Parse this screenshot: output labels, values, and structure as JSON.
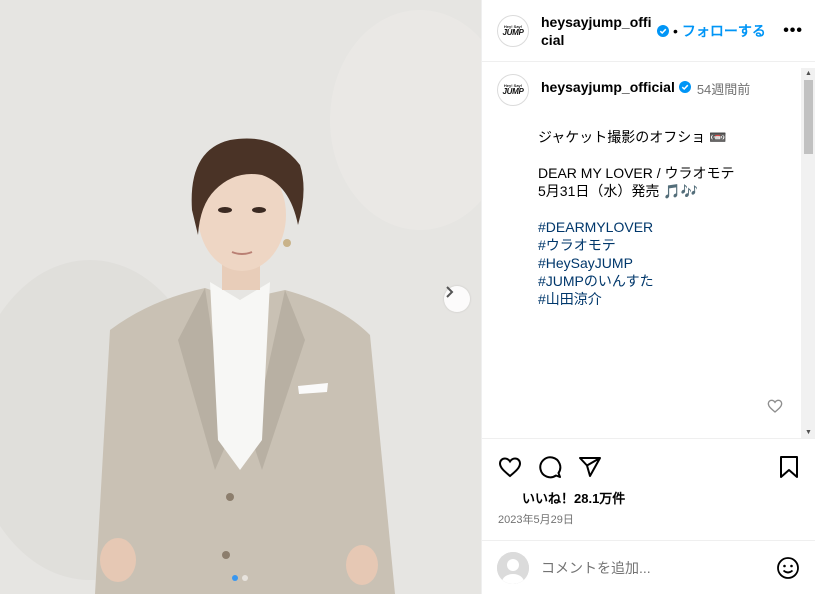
{
  "post": {
    "username": "heysayjump_official",
    "header_username_line1": "heysayjump_offici",
    "header_username_line2": "al",
    "separator": "•",
    "follow_label": "フォローする",
    "more_label": "•••",
    "avatar_text_top": "Hey! Say!",
    "avatar_text_bottom": "JUMP",
    "time_ago": "54週間前",
    "caption_lines": [
      "ジャケット撮影のオフショ 📼",
      "",
      "DEAR MY LOVER / ウラオモテ",
      "5月31日（水）発売 🎵🎶",
      ""
    ],
    "hashtags": [
      "#DEARMYLOVER",
      "#ウラオモテ",
      "#HeySayJUMP",
      "#JUMPのいんすた",
      "#山田涼介"
    ],
    "likes_label": "いいね！28.1万件",
    "date": "2023年5月29日",
    "comment_placeholder": "コメントを追加..."
  },
  "carousel": {
    "current": 1,
    "total": 2,
    "next_icon": "chevron-right-icon"
  },
  "colors": {
    "accent": "#0095f6",
    "verified": "#0095f6",
    "hashtag": "#00376b",
    "muted": "#737373"
  },
  "icons": [
    "heart-icon",
    "comment-icon",
    "share-icon",
    "bookmark-icon",
    "emoji-icon",
    "verified-icon"
  ]
}
